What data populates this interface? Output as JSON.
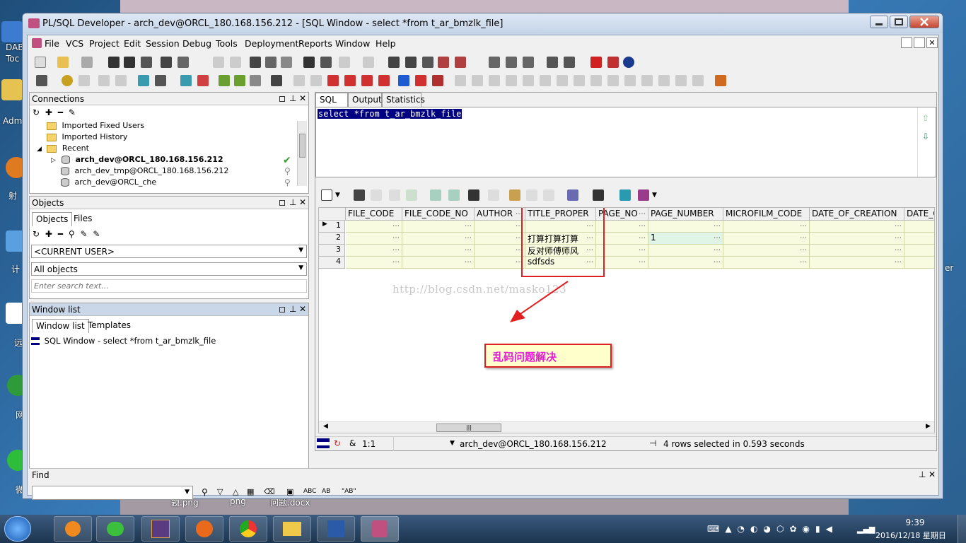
{
  "window": {
    "title": "PL/SQL Developer - arch_dev@ORCL_180.168.156.212 - [SQL Window - select *from t_ar_bmzlk_file]"
  },
  "desktop": {
    "left_labels": [
      "DAB",
      "Toc",
      "Adm",
      "射",
      "计",
      "远",
      "网",
      "微"
    ],
    "right_label": "er",
    "strip_labels": [
      "题.png",
      "png",
      "问题.docx"
    ]
  },
  "menu": [
    "File",
    "VCS",
    "Project",
    "Edit",
    "Session",
    "Debug",
    "Tools",
    "Deployment",
    "Reports",
    "Window",
    "Help"
  ],
  "connections": {
    "title": "Connections",
    "items": [
      {
        "label": "Imported Fixed Users",
        "kind": "folder"
      },
      {
        "label": "Imported History",
        "kind": "folder"
      },
      {
        "label": "Recent",
        "kind": "folder"
      },
      {
        "label": "arch_dev@ORCL_180.168.156.212",
        "kind": "db"
      },
      {
        "label": "arch_dev_tmp@ORCL_180.168.156.212",
        "kind": "db"
      },
      {
        "label": "arch_dev@ORCL_che",
        "kind": "db"
      }
    ]
  },
  "objects": {
    "title": "Objects",
    "tabs": [
      "Objects",
      "Files"
    ],
    "user_select": "<CURRENT USER>",
    "filter_select": "All objects",
    "search_placeholder": "Enter search text..."
  },
  "window_list": {
    "title": "Window list",
    "tabs": [
      "Window list",
      "Templates"
    ],
    "item": "SQL Window - select *from t_ar_bmzlk_file"
  },
  "editor": {
    "tabs": [
      "SQL",
      "Output",
      "Statistics"
    ],
    "sql": "select *from t_ar_bmzlk_file"
  },
  "grid": {
    "columns": [
      "FILE_CODE",
      "FILE_CODE_NO",
      "AUTHOR",
      "TITLE_PROPER",
      "PAGE_NO",
      "PAGE_NUMBER",
      "MICROFILM_CODE",
      "DATE_OF_CREATION",
      "DATE_C"
    ],
    "rows": [
      {
        "n": "1",
        "title_proper": "",
        "page_number": ""
      },
      {
        "n": "2",
        "title_proper": "打算打算打算",
        "page_number": "1"
      },
      {
        "n": "3",
        "title_proper": "反对师傅师风",
        "page_number": ""
      },
      {
        "n": "4",
        "title_proper": "sdfsds",
        "page_number": ""
      }
    ]
  },
  "watermark": "http://blog.csdn.net/masko123",
  "annotation": "乱码问题解决",
  "status": {
    "position": "1:1",
    "connection": "arch_dev@ORCL_180.168.156.212",
    "message": "4 rows selected in 0.593 seconds"
  },
  "find": {
    "title": "Find"
  },
  "taskbar": {
    "time": "9:39",
    "date": "2016/12/18 星期日"
  },
  "colors": {
    "highlight_red": "#e02020",
    "grid_yellow": "#f8fbe0",
    "sql_selection": "#000080",
    "annotation_text": "#e020d0"
  }
}
